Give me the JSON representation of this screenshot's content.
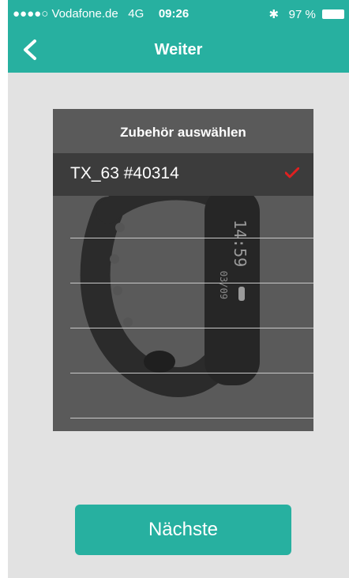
{
  "status_bar": {
    "carrier": "●●●●○ Vodafone.de",
    "network": "4G",
    "time": "09:26",
    "bluetooth_icon": "bluetooth-icon",
    "battery": "97 %"
  },
  "nav": {
    "back_icon": "chevron-left-icon",
    "title": "Weiter"
  },
  "list": {
    "title": "Zubehör auswählen",
    "items": [
      {
        "label": "TX_63 #40314",
        "selected": true
      }
    ]
  },
  "band_display": {
    "time": "14:59",
    "date": "03/09"
  },
  "next_button": {
    "label": "Nächste"
  },
  "colors": {
    "accent": "#27b0a0",
    "panel": "#5a5a5a",
    "selected_row": "#3c3c3c",
    "check": "#e02020",
    "background": "#e2e2e2"
  }
}
